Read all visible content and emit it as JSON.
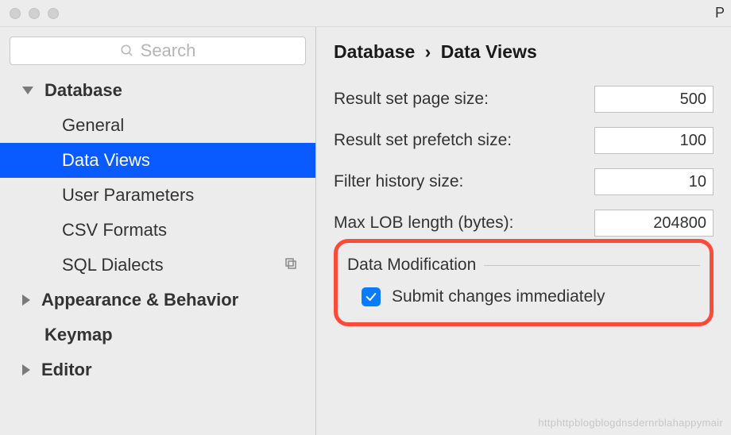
{
  "titlebar": {
    "title_tail": "P"
  },
  "search": {
    "placeholder": "Search"
  },
  "sidebar": {
    "items": [
      {
        "label": "Database",
        "kind": "top",
        "expanded": true
      },
      {
        "label": "General",
        "kind": "leaf"
      },
      {
        "label": "Data Views",
        "kind": "leaf",
        "selected": true
      },
      {
        "label": "User Parameters",
        "kind": "leaf"
      },
      {
        "label": "CSV Formats",
        "kind": "leaf"
      },
      {
        "label": "SQL Dialects",
        "kind": "leaf",
        "trailing_icon": "copy-settings-icon"
      },
      {
        "label": "Appearance & Behavior",
        "kind": "top",
        "expanded": false
      },
      {
        "label": "Keymap",
        "kind": "top",
        "expanded": null
      },
      {
        "label": "Editor",
        "kind": "top",
        "expanded": false
      }
    ]
  },
  "breadcrumb": {
    "parent": "Database",
    "sep": "›",
    "current": "Data Views"
  },
  "fields": {
    "page_size": {
      "label": "Result set page size:",
      "value": "500"
    },
    "prefetch_size": {
      "label": "Result set prefetch size:",
      "value": "100"
    },
    "filter_history": {
      "label": "Filter history size:",
      "value": "10"
    },
    "max_lob": {
      "label": "Max LOB length (bytes):",
      "value": "204800"
    }
  },
  "section": {
    "data_mod": "Data Modification"
  },
  "checkbox": {
    "submit_immediately": {
      "label": "Submit changes immediately",
      "checked": true
    }
  },
  "watermark": "httphttpblogblogdnsdernrblahappymair"
}
